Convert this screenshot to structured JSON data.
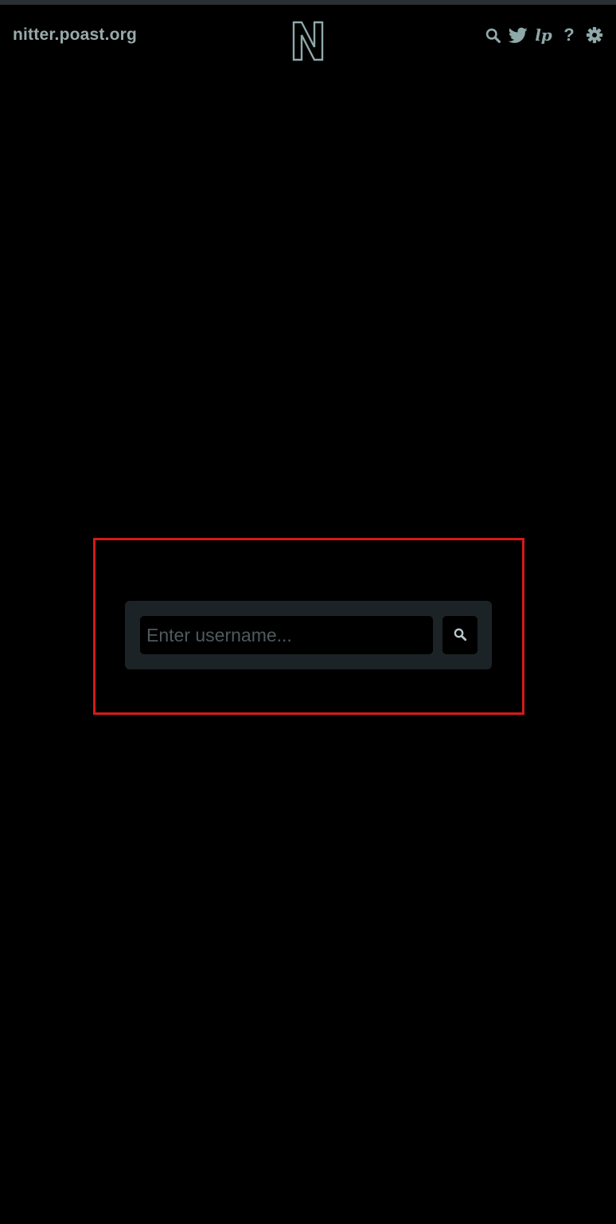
{
  "header": {
    "site_name": "nitter.poast.org",
    "logo_icon": "nitter-logo-icon",
    "nav_icons": [
      {
        "name": "search-icon"
      },
      {
        "name": "twitter-bird-icon"
      },
      {
        "name": "lp-icon",
        "label": "lp"
      },
      {
        "name": "help-icon",
        "label": "?"
      },
      {
        "name": "gear-icon"
      }
    ]
  },
  "search": {
    "placeholder": "Enter username...",
    "value": "",
    "button_icon": "search-icon"
  },
  "colors": {
    "background": "#000000",
    "accent": "#8fa8aa",
    "panel": "#1c2326",
    "highlight": "#d41a1a"
  }
}
